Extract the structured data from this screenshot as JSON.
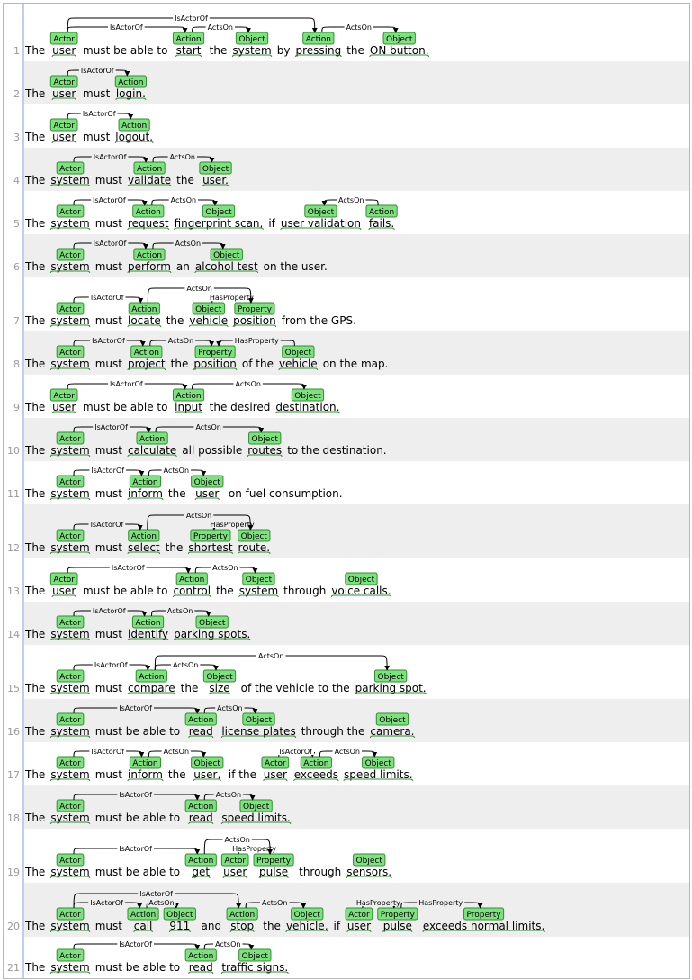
{
  "sentences": [
    {
      "n": "1",
      "words": [
        "The",
        "user",
        "must be able to",
        "start",
        "the",
        "system",
        "by",
        "pressing",
        "the",
        "ON button."
      ],
      "spans": [
        {
          "w": 1,
          "type": "Actor"
        },
        {
          "w": 3,
          "type": "Action"
        },
        {
          "w": 5,
          "type": "Object"
        },
        {
          "w": 7,
          "type": "Action"
        },
        {
          "w": 9,
          "type": "Object"
        }
      ],
      "arcs": [
        {
          "from": 1,
          "to": 3,
          "label": "IsActorOf"
        },
        {
          "from": 1,
          "to": 7,
          "label": "IsActorOf"
        },
        {
          "from": 3,
          "to": 5,
          "label": "ActsOn"
        },
        {
          "from": 7,
          "to": 9,
          "label": "ActsOn"
        }
      ]
    },
    {
      "n": "2",
      "words": [
        "The",
        "user",
        "must",
        "login."
      ],
      "spans": [
        {
          "w": 1,
          "type": "Actor"
        },
        {
          "w": 3,
          "type": "Action"
        }
      ],
      "arcs": [
        {
          "from": 1,
          "to": 3,
          "label": "IsActorOf"
        }
      ]
    },
    {
      "n": "3",
      "words": [
        "The",
        "user",
        "must",
        "logout."
      ],
      "spans": [
        {
          "w": 1,
          "type": "Actor"
        },
        {
          "w": 3,
          "type": "Action"
        }
      ],
      "arcs": [
        {
          "from": 1,
          "to": 3,
          "label": "IsActorOf"
        }
      ]
    },
    {
      "n": "4",
      "words": [
        "The",
        "system",
        "must",
        "validate",
        "the",
        "user."
      ],
      "spans": [
        {
          "w": 1,
          "type": "Actor"
        },
        {
          "w": 3,
          "type": "Action"
        },
        {
          "w": 5,
          "type": "Object"
        }
      ],
      "arcs": [
        {
          "from": 1,
          "to": 3,
          "label": "IsActorOf"
        },
        {
          "from": 3,
          "to": 5,
          "label": "ActsOn"
        }
      ]
    },
    {
      "n": "5",
      "words": [
        "The",
        "system",
        "must",
        "request",
        "fingerprint scan,",
        "if",
        "user validation",
        "fails."
      ],
      "spans": [
        {
          "w": 1,
          "type": "Actor"
        },
        {
          "w": 3,
          "type": "Action"
        },
        {
          "w": 4,
          "type": "Object"
        },
        {
          "w": 6,
          "type": "Object"
        },
        {
          "w": 7,
          "type": "Action"
        }
      ],
      "arcs": [
        {
          "from": 1,
          "to": 3,
          "label": "IsActorOf"
        },
        {
          "from": 3,
          "to": 4,
          "label": "ActsOn"
        },
        {
          "from": 7,
          "to": 6,
          "label": "ActsOn"
        }
      ]
    },
    {
      "n": "6",
      "words": [
        "The",
        "system",
        "must",
        "perform",
        "an",
        "alcohol test",
        "on the user."
      ],
      "spans": [
        {
          "w": 1,
          "type": "Actor"
        },
        {
          "w": 3,
          "type": "Action"
        },
        {
          "w": 5,
          "type": "Object"
        }
      ],
      "arcs": [
        {
          "from": 1,
          "to": 3,
          "label": "IsActorOf"
        },
        {
          "from": 3,
          "to": 5,
          "label": "ActsOn"
        }
      ]
    },
    {
      "n": "7",
      "words": [
        "The",
        "system",
        "must",
        "locate",
        "the",
        "vehicle",
        "position",
        "from the GPS."
      ],
      "spans": [
        {
          "w": 1,
          "type": "Actor"
        },
        {
          "w": 3,
          "type": "Action"
        },
        {
          "w": 5,
          "type": "Object"
        },
        {
          "w": 6,
          "type": "Property"
        }
      ],
      "arcs": [
        {
          "from": 1,
          "to": 3,
          "label": "IsActorOf"
        },
        {
          "from": 5,
          "to": 6,
          "label": "HasProperty"
        },
        {
          "from": 3,
          "to": 6,
          "label": "ActsOn"
        }
      ]
    },
    {
      "n": "8",
      "words": [
        "The",
        "system",
        "must",
        "project",
        "the",
        "position",
        "of the",
        "vehicle",
        "on the map."
      ],
      "spans": [
        {
          "w": 1,
          "type": "Actor"
        },
        {
          "w": 3,
          "type": "Action"
        },
        {
          "w": 5,
          "type": "Property"
        },
        {
          "w": 7,
          "type": "Object"
        }
      ],
      "arcs": [
        {
          "from": 1,
          "to": 3,
          "label": "IsActorOf"
        },
        {
          "from": 3,
          "to": 5,
          "label": "ActsOn"
        },
        {
          "from": 7,
          "to": 5,
          "label": "HasProperty"
        }
      ]
    },
    {
      "n": "9",
      "words": [
        "The",
        "user",
        "must be able to",
        "input",
        "the desired",
        "destination."
      ],
      "spans": [
        {
          "w": 1,
          "type": "Actor"
        },
        {
          "w": 3,
          "type": "Action"
        },
        {
          "w": 5,
          "type": "Object"
        }
      ],
      "arcs": [
        {
          "from": 1,
          "to": 3,
          "label": "IsActorOf"
        },
        {
          "from": 3,
          "to": 5,
          "label": "ActsOn"
        }
      ]
    },
    {
      "n": "10",
      "words": [
        "The",
        "system",
        "must",
        "calculate",
        "all possible",
        "routes",
        "to the destination."
      ],
      "spans": [
        {
          "w": 1,
          "type": "Actor"
        },
        {
          "w": 3,
          "type": "Action"
        },
        {
          "w": 5,
          "type": "Object"
        }
      ],
      "arcs": [
        {
          "from": 1,
          "to": 3,
          "label": "IsActorOf"
        },
        {
          "from": 3,
          "to": 5,
          "label": "ActsOn"
        }
      ]
    },
    {
      "n": "11",
      "words": [
        "The",
        "system",
        "must",
        "inform",
        "the",
        "user",
        "on fuel consumption."
      ],
      "spans": [
        {
          "w": 1,
          "type": "Actor"
        },
        {
          "w": 3,
          "type": "Action"
        },
        {
          "w": 5,
          "type": "Object"
        }
      ],
      "arcs": [
        {
          "from": 1,
          "to": 3,
          "label": "IsActorOf"
        },
        {
          "from": 3,
          "to": 5,
          "label": "ActsOn"
        }
      ]
    },
    {
      "n": "12",
      "words": [
        "The",
        "system",
        "must",
        "select",
        "the",
        "shortest",
        "route."
      ],
      "spans": [
        {
          "w": 1,
          "type": "Actor"
        },
        {
          "w": 3,
          "type": "Action"
        },
        {
          "w": 5,
          "type": "Property"
        },
        {
          "w": 6,
          "type": "Object"
        }
      ],
      "arcs": [
        {
          "from": 1,
          "to": 3,
          "label": "IsActorOf"
        },
        {
          "from": 6,
          "to": 5,
          "label": "HasProperty"
        },
        {
          "from": 3,
          "to": 6,
          "label": "ActsOn"
        }
      ]
    },
    {
      "n": "13",
      "words": [
        "The",
        "user",
        "must be able to",
        "control",
        "the",
        "system",
        "through",
        "voice calls."
      ],
      "spans": [
        {
          "w": 1,
          "type": "Actor"
        },
        {
          "w": 3,
          "type": "Action"
        },
        {
          "w": 5,
          "type": "Object"
        },
        {
          "w": 7,
          "type": "Object"
        }
      ],
      "arcs": [
        {
          "from": 1,
          "to": 3,
          "label": "IsActorOf"
        },
        {
          "from": 3,
          "to": 5,
          "label": "ActsOn"
        }
      ]
    },
    {
      "n": "14",
      "words": [
        "The",
        "system",
        "must",
        "identify",
        "parking spots."
      ],
      "spans": [
        {
          "w": 1,
          "type": "Actor"
        },
        {
          "w": 3,
          "type": "Action"
        },
        {
          "w": 4,
          "type": "Object"
        }
      ],
      "arcs": [
        {
          "from": 1,
          "to": 3,
          "label": "IsActorOf"
        },
        {
          "from": 3,
          "to": 4,
          "label": "ActsOn"
        }
      ]
    },
    {
      "n": "15",
      "words": [
        "The",
        "system",
        "must",
        "compare",
        "the",
        "size",
        "of the vehicle to the",
        "parking spot."
      ],
      "spans": [
        {
          "w": 1,
          "type": "Actor"
        },
        {
          "w": 3,
          "type": "Action"
        },
        {
          "w": 5,
          "type": "Object"
        },
        {
          "w": 7,
          "type": "Object"
        }
      ],
      "arcs": [
        {
          "from": 1,
          "to": 3,
          "label": "IsActorOf"
        },
        {
          "from": 3,
          "to": 5,
          "label": "ActsOn"
        },
        {
          "from": 3,
          "to": 7,
          "label": "ActsOn"
        }
      ]
    },
    {
      "n": "16",
      "words": [
        "The",
        "system",
        "must be able to",
        "read",
        "license plates",
        "through the",
        "camera."
      ],
      "spans": [
        {
          "w": 1,
          "type": "Actor"
        },
        {
          "w": 3,
          "type": "Action"
        },
        {
          "w": 4,
          "type": "Object"
        },
        {
          "w": 6,
          "type": "Object"
        }
      ],
      "arcs": [
        {
          "from": 1,
          "to": 3,
          "label": "IsActorOf"
        },
        {
          "from": 3,
          "to": 4,
          "label": "ActsOn"
        }
      ]
    },
    {
      "n": "17",
      "words": [
        "The",
        "system",
        "must",
        "inform",
        "the",
        "user,",
        "if the",
        "user",
        "exceeds",
        "speed limits."
      ],
      "spans": [
        {
          "w": 1,
          "type": "Actor"
        },
        {
          "w": 3,
          "type": "Action"
        },
        {
          "w": 5,
          "type": "Object"
        },
        {
          "w": 7,
          "type": "Actor"
        },
        {
          "w": 8,
          "type": "Action"
        },
        {
          "w": 9,
          "type": "Object"
        }
      ],
      "arcs": [
        {
          "from": 1,
          "to": 3,
          "label": "IsActorOf"
        },
        {
          "from": 3,
          "to": 5,
          "label": "ActsOn"
        },
        {
          "from": 7,
          "to": 8,
          "label": "IsActorOf"
        },
        {
          "from": 8,
          "to": 9,
          "label": "ActsOn"
        }
      ]
    },
    {
      "n": "18",
      "words": [
        "The",
        "system",
        "must be able to",
        "read",
        "speed limits."
      ],
      "spans": [
        {
          "w": 1,
          "type": "Actor"
        },
        {
          "w": 3,
          "type": "Action"
        },
        {
          "w": 4,
          "type": "Object"
        }
      ],
      "arcs": [
        {
          "from": 1,
          "to": 3,
          "label": "IsActorOf"
        },
        {
          "from": 3,
          "to": 4,
          "label": "ActsOn"
        }
      ]
    },
    {
      "n": "19",
      "words": [
        "The",
        "system",
        "must be able to",
        "get",
        "user",
        "pulse",
        "through",
        "sensors."
      ],
      "spans": [
        {
          "w": 1,
          "type": "Actor"
        },
        {
          "w": 3,
          "type": "Action"
        },
        {
          "w": 4,
          "type": "Actor"
        },
        {
          "w": 5,
          "type": "Property"
        },
        {
          "w": 7,
          "type": "Object"
        }
      ],
      "arcs": [
        {
          "from": 1,
          "to": 3,
          "label": "IsActorOf"
        },
        {
          "from": 4,
          "to": 5,
          "label": "HasProperty"
        },
        {
          "from": 3,
          "to": 5,
          "label": "ActsOn"
        }
      ]
    },
    {
      "n": "20",
      "words": [
        "The",
        "system",
        "must",
        "call",
        "911",
        "and",
        "stop",
        "the",
        "vehicle,",
        "if",
        "user",
        "pulse",
        "exceeds normal limits."
      ],
      "spans": [
        {
          "w": 1,
          "type": "Actor"
        },
        {
          "w": 3,
          "type": "Action"
        },
        {
          "w": 4,
          "type": "Object"
        },
        {
          "w": 6,
          "type": "Action"
        },
        {
          "w": 8,
          "type": "Object"
        },
        {
          "w": 10,
          "type": "Actor"
        },
        {
          "w": 11,
          "type": "Property"
        },
        {
          "w": 12,
          "type": "Property"
        }
      ],
      "arcs": [
        {
          "from": 1,
          "to": 3,
          "label": "IsActorOf"
        },
        {
          "from": 1,
          "to": 6,
          "label": "IsActorOf"
        },
        {
          "from": 3,
          "to": 4,
          "label": "ActsOn"
        },
        {
          "from": 6,
          "to": 8,
          "label": "ActsOn"
        },
        {
          "from": 10,
          "to": 11,
          "label": "HasProperty"
        },
        {
          "from": 11,
          "to": 12,
          "label": "HasProperty"
        }
      ]
    },
    {
      "n": "21",
      "words": [
        "The",
        "system",
        "must be able to",
        "read",
        "traffic signs."
      ],
      "spans": [
        {
          "w": 1,
          "type": "Actor"
        },
        {
          "w": 3,
          "type": "Action"
        },
        {
          "w": 4,
          "type": "Object"
        }
      ],
      "arcs": [
        {
          "from": 1,
          "to": 3,
          "label": "IsActorOf"
        },
        {
          "from": 3,
          "to": 4,
          "label": "ActsOn"
        }
      ]
    }
  ],
  "colors": {
    "span_fill": "#7fe07f",
    "span_stroke": "#2f8f2f",
    "row_alt": "#eeeeee",
    "row": "#ffffff",
    "gutter_line": "#7b9fe0",
    "arc": "#000000",
    "line_number": "#9a9a9a"
  }
}
